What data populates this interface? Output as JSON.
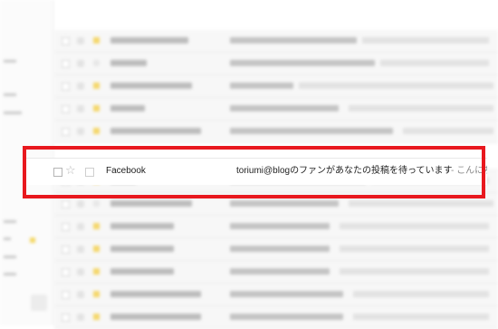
{
  "focused_email": {
    "sender": "Facebook",
    "subject": "toriumi@blogのファンがあなたの投稿を待っています",
    "snippet": " - こんにちは"
  },
  "colors": {
    "highlight_frame": "#e8181e",
    "label_yellow": "#f5d76a"
  },
  "icons": {
    "star": "star-icon",
    "checkbox": "checkbox-icon",
    "important": "important-marker-icon"
  }
}
